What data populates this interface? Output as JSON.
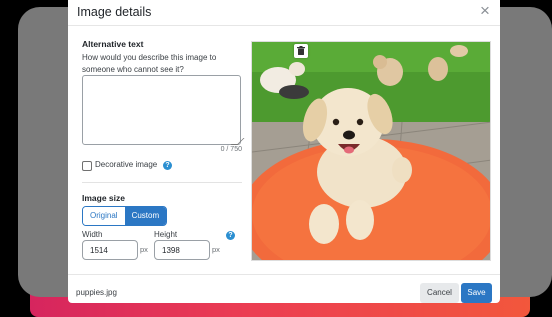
{
  "dialog": {
    "title": "Image details",
    "close_glyph": "×"
  },
  "alt_text": {
    "heading": "Alternative text",
    "help": "How would you describe this image to someone who cannot see it?",
    "value": "",
    "counter": "0 / 750"
  },
  "decorative": {
    "label": "Decorative image",
    "checked": false,
    "help_glyph": "?"
  },
  "image_size": {
    "heading": "Image size",
    "options": [
      "Original",
      "Custom"
    ],
    "selected": "Custom",
    "width_label": "Width",
    "height_label": "Height",
    "width_value": "1514",
    "height_value": "1398",
    "unit": "px",
    "help_glyph": "?"
  },
  "preview": {
    "delete_icon": "trash-icon"
  },
  "footer": {
    "filename": "puppies.jpg",
    "cancel_label": "Cancel",
    "save_label": "Save"
  },
  "colors": {
    "accent": "#2b77c4",
    "help_icon": "#2b8fd1",
    "mat": "#f26a3c",
    "grass": "#4d9a2f"
  }
}
